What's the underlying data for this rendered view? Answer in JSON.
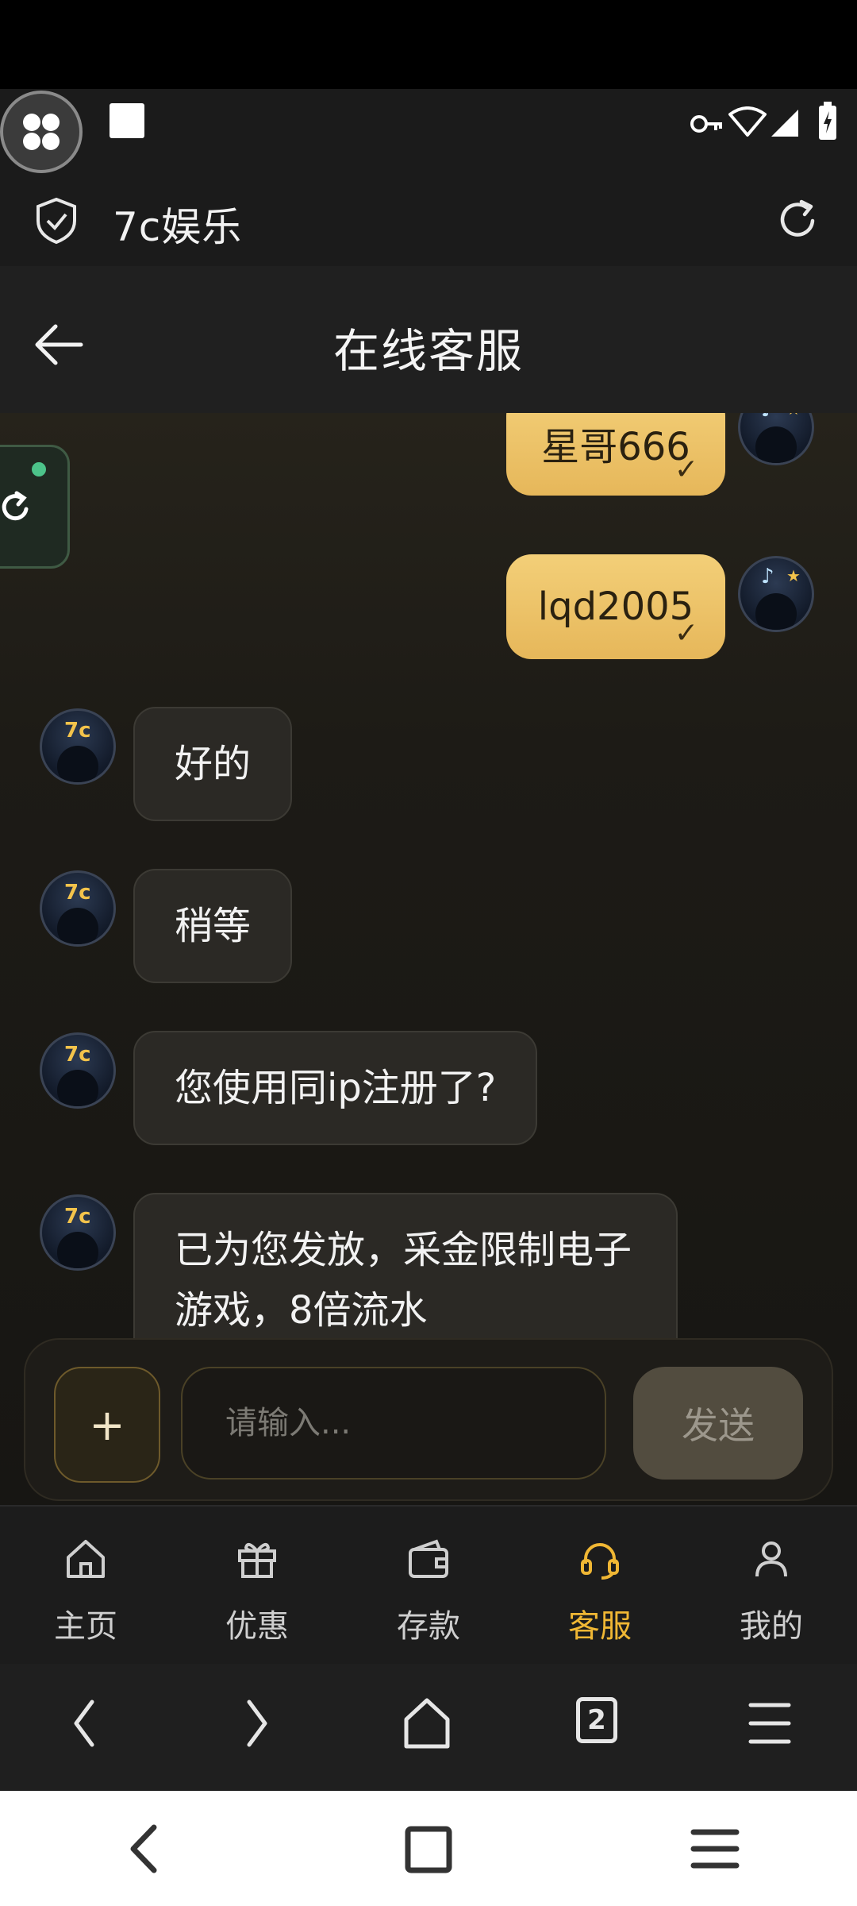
{
  "browser": {
    "site_title": "7c娱乐"
  },
  "header": {
    "title": "在线客服"
  },
  "messages": [
    {
      "side": "out",
      "text": "星哥666",
      "check": "✓"
    },
    {
      "side": "out",
      "text": "lqd2005",
      "check": "✓"
    },
    {
      "side": "in",
      "text": "好的"
    },
    {
      "side": "in",
      "text": "稍等"
    },
    {
      "side": "in",
      "text": "您使用同ip注册了?"
    },
    {
      "side": "in",
      "text": "已为您发放，采金限制电子游戏，8倍流水"
    }
  ],
  "avatar_marks": {
    "agent": "7c",
    "user": "♪"
  },
  "input": {
    "plus_label": "+",
    "placeholder": "请输入...",
    "send_label": "发送"
  },
  "tabs": [
    {
      "label": "主页",
      "icon": "home-icon"
    },
    {
      "label": "优惠",
      "icon": "gift-icon"
    },
    {
      "label": "存款",
      "icon": "wallet-icon"
    },
    {
      "label": "客服",
      "icon": "headset-icon",
      "active": true
    },
    {
      "label": "我的",
      "icon": "user-icon"
    }
  ],
  "browser_nav": {
    "tab_count": "2"
  },
  "colors": {
    "accent": "#f0b734",
    "bubble_out": "#ebc165",
    "bg": "#1b1b1b"
  }
}
